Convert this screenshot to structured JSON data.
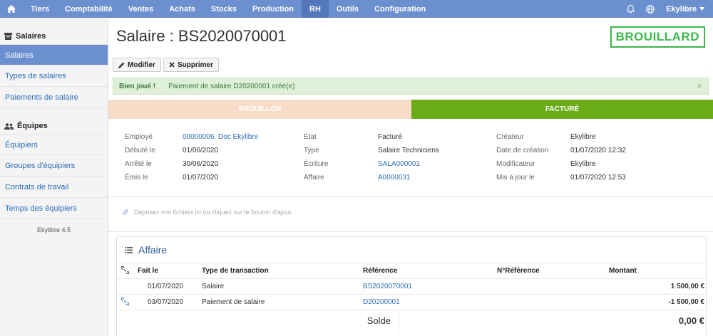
{
  "topnav": {
    "items": [
      "Tiers",
      "Comptabilité",
      "Ventes",
      "Achats",
      "Stocks",
      "Production",
      "RH",
      "Outils",
      "Configuration"
    ],
    "active": "RH",
    "user": "Ekylibre"
  },
  "sidebar": {
    "group1": "Salaires",
    "group1_items": [
      "Salaires",
      "Types de salaires",
      "Paiements de salaire"
    ],
    "group2": "Équipes",
    "group2_items": [
      "Équipiers",
      "Groupes d'équipiers",
      "Contrats de travail",
      "Temps des équipiers"
    ],
    "version": "Ekylibre 4.5"
  },
  "page": {
    "title": "Salaire : BS2020070001",
    "badge": "BROUILLARD",
    "edit_label": "Modifier",
    "delete_label": "Supprimer"
  },
  "alert": {
    "strong": "Bien joué !",
    "message": "Paiement de salaire D20200001 créé(e)",
    "close": "×"
  },
  "steps": {
    "step1": "BROUILLON",
    "step2": "FACTURÉ"
  },
  "details": {
    "col1": [
      {
        "label": "Employé",
        "value": "00000006. Doc Ekylibre"
      },
      {
        "label": "Débuté le",
        "value": "01/06/2020"
      },
      {
        "label": "Arrêté le",
        "value": "30/06/2020"
      },
      {
        "label": "Émis le",
        "value": "01/07/2020"
      }
    ],
    "col2": [
      {
        "label": "État",
        "value": "Facturé"
      },
      {
        "label": "Type",
        "value": "Salaire Techniciens"
      },
      {
        "label": "Écriture",
        "value": "SALA000001"
      },
      {
        "label": "Affaire",
        "value": "A0000031"
      }
    ],
    "col3": [
      {
        "label": "Créateur",
        "value": "Ekylibre"
      },
      {
        "label": "Date de création",
        "value": "01/07/2020 12:32"
      },
      {
        "label": "Modificateur",
        "value": "Ekylibre"
      },
      {
        "label": "Mis à jour le",
        "value": "01/07/2020 12:53"
      }
    ]
  },
  "dropzone": "Déposez vos fichiers ici ou cliquez sur le bouton d'ajout",
  "affaire": {
    "title": "Affaire",
    "headers": [
      "Fait le",
      "Type de transaction",
      "Référence",
      "N°Référence",
      "Montant"
    ],
    "rows": [
      {
        "date": "01/07/2020",
        "type": "Salaire",
        "ref": "BS2020070001",
        "nref": "",
        "amount": "1 500,00 €"
      },
      {
        "date": "03/07/2020",
        "type": "Paiement de salaire",
        "ref": "D20200001",
        "nref": "",
        "amount": "-1 500,00 €"
      }
    ],
    "total_label": "Solde",
    "total_value": "0,00 €"
  },
  "icons": {
    "home": "home-icon",
    "bell": "bell-icon",
    "globe": "globe-icon",
    "caret": "caret-down-icon",
    "salaires_group": "box-icon",
    "equipes_group": "users-icon",
    "edit": "pencil-icon",
    "delete": "times-icon",
    "attach": "paperclip-icon",
    "list": "list-icon",
    "link": "unlink-icon"
  },
  "colors": {
    "nav": "#6c8fcf",
    "nav_active": "#5478bb",
    "badge": "#3cb84a",
    "step_done": "#f8dcc7",
    "step_current": "#6bab19",
    "alert_bg": "#dff0d8",
    "link": "#2a6ebb"
  }
}
